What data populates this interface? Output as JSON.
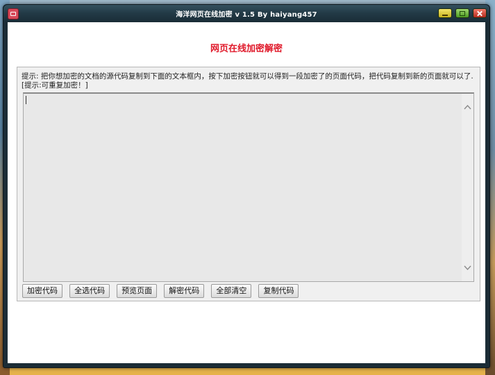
{
  "window": {
    "title": "海洋网页在线加密 v 1.5  By haiyang457"
  },
  "main": {
    "heading": "网页在线加密解密",
    "hint": "提示: 把你想加密的文档的源代码复制到下面的文本框内，按下加密按钮就可以得到一段加密了的页面代码，把代码复制到新的页面就可以了. [提示:可重复加密！]",
    "code_input_value": ""
  },
  "buttons": [
    "加密代码",
    "全选代码",
    "预览页面",
    "解密代码",
    "全部清空",
    "复制代码"
  ],
  "colors": {
    "heading": "#e0192a",
    "textarea_bg": "#e8e8e8"
  }
}
